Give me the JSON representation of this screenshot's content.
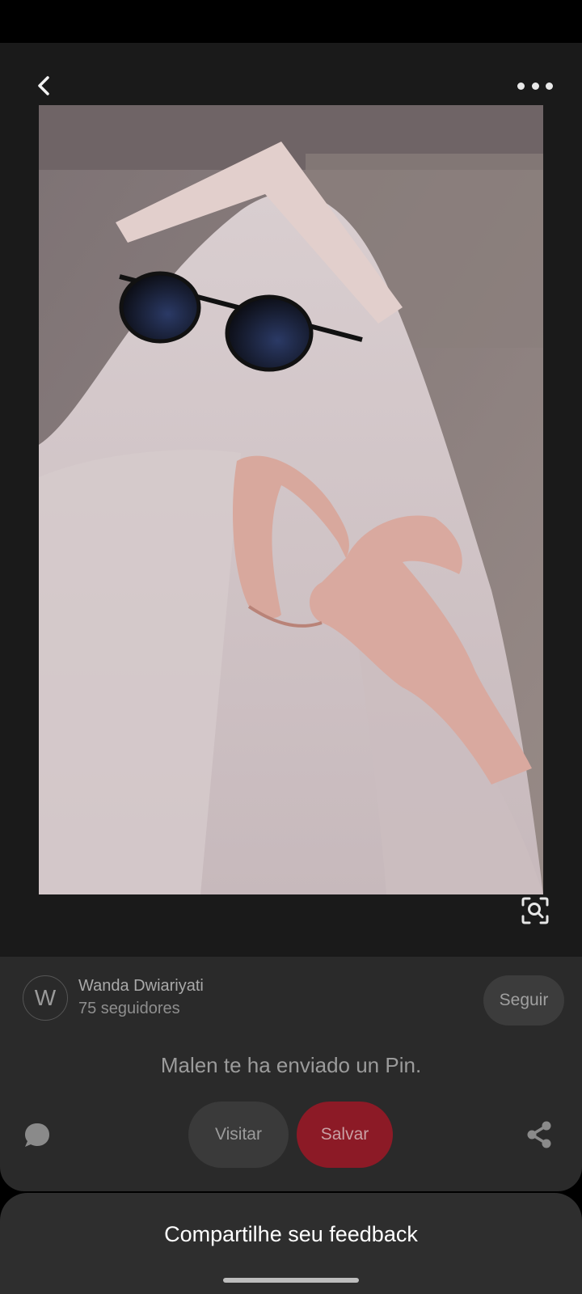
{
  "header": {
    "back_icon": "chevron-left-icon",
    "more_icon": "more-horizontal-icon"
  },
  "pin": {
    "image_description_icon": "ghost-photo",
    "lens_icon": "visual-search-icon"
  },
  "author": {
    "avatar_initial": "W",
    "name": "Wanda Dwiariyati",
    "followers": "75 seguidores",
    "follow_label": "Seguir"
  },
  "message": "Malen te ha enviado un Pin.",
  "actions": {
    "comment_icon": "comment-icon",
    "visit_label": "Visitar",
    "save_label": "Salvar",
    "share_icon": "share-icon",
    "save_color": "#8c1a26"
  },
  "feedback": {
    "label": "Compartilhe seu feedback"
  }
}
